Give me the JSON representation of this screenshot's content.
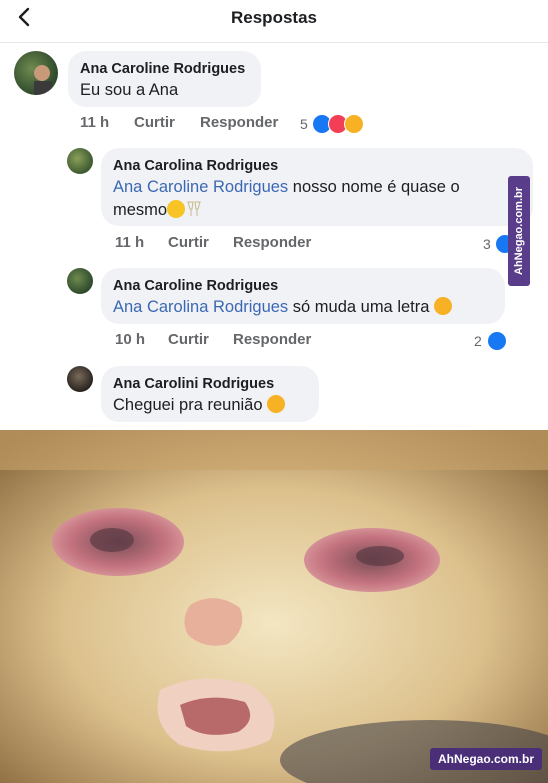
{
  "header": {
    "title": "Respostas"
  },
  "comments": [
    {
      "name": "Ana Caroline Rodrigues",
      "text": "Eu sou a Ana",
      "time": "11 h",
      "like": "Curtir",
      "reply": "Responder",
      "reactions": "5"
    },
    {
      "name": "Ana Carolina Rodrigues",
      "mention": "Ana Caroline Rodrigues",
      "text_line1": " nosso nome é quase o",
      "text_line2": "mesmo",
      "time": "11 h",
      "like": "Curtir",
      "reply": "Responder",
      "reactions": "3"
    },
    {
      "name": "Ana Caroline Rodrigues",
      "mention": "Ana Carolina Rodrigues",
      "text": " só muda uma letra",
      "time": "10 h",
      "like": "Curtir",
      "reply": "Responder",
      "reactions": "2"
    },
    {
      "name": "Ana Carolini Rodrigues",
      "text": "Cheguei pra reunião"
    }
  ],
  "watermark": "AhNegao.com.br",
  "colors": {
    "mention": "#3b68b5",
    "like": "#1877f2",
    "love": "#f33e58",
    "haha": "#f7b125",
    "bubble": "#f0f2f5"
  }
}
